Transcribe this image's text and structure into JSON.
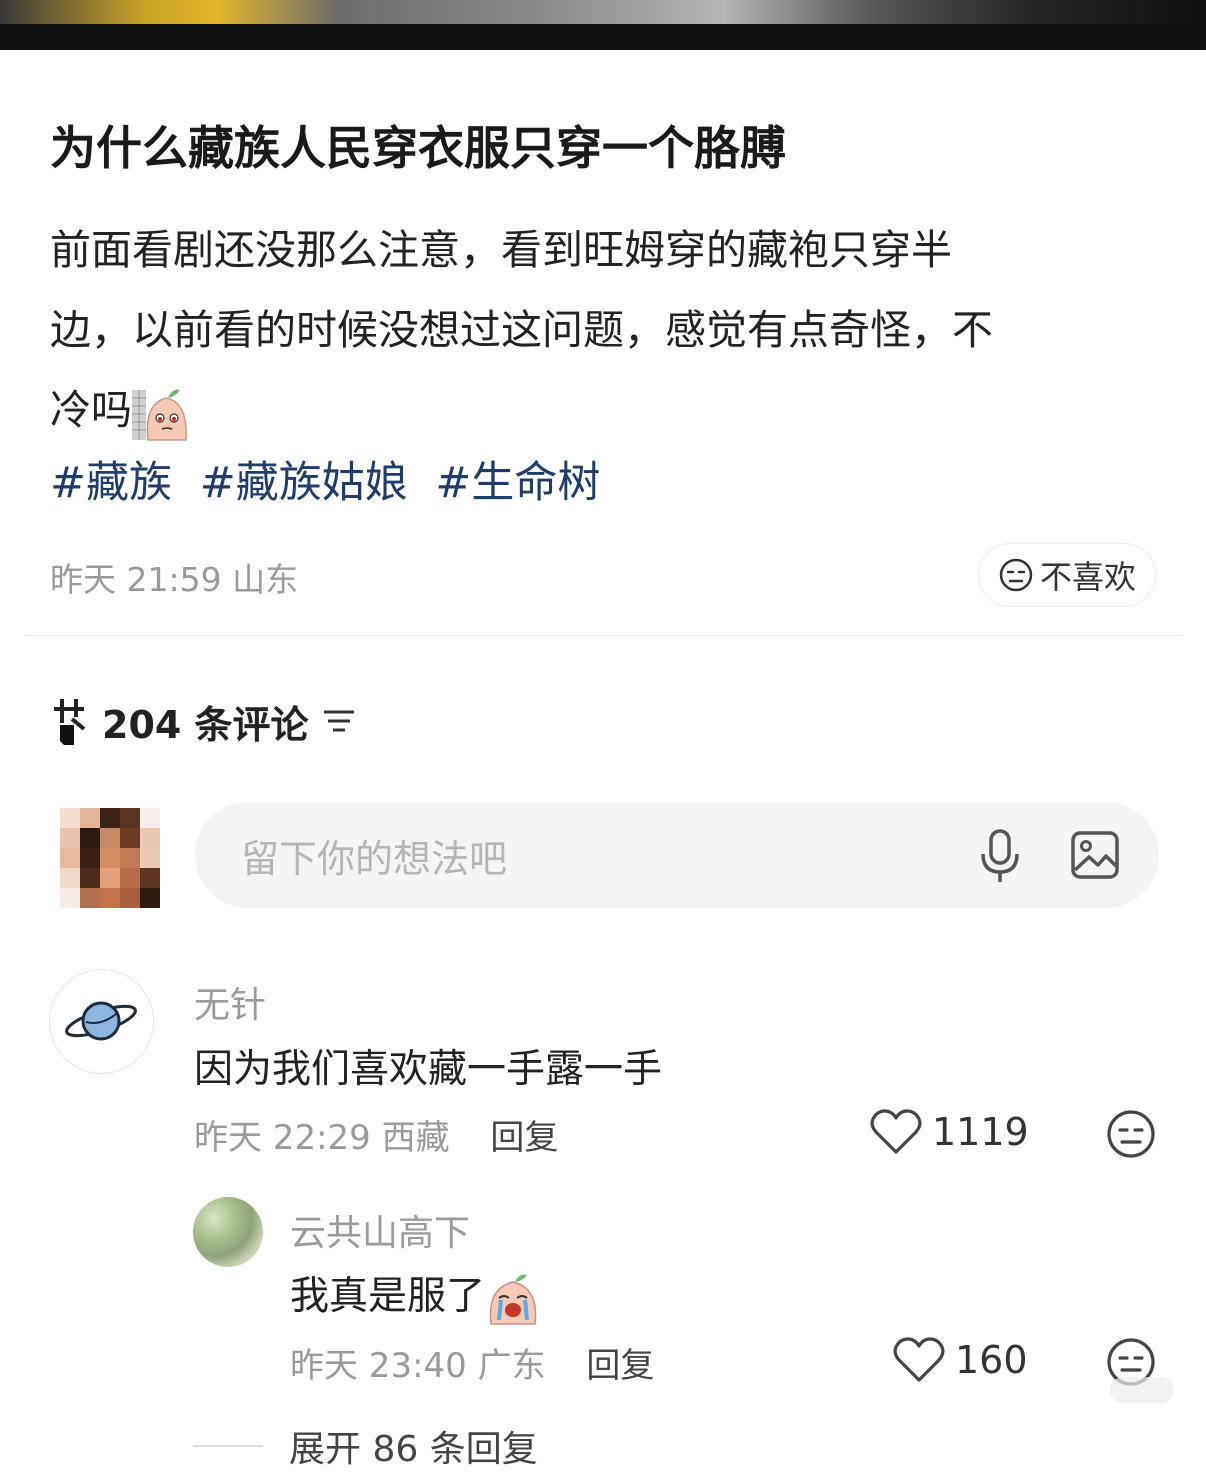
{
  "post": {
    "title": "为什么藏族人民穿衣服只穿一个胳膊",
    "body_line1": "前面看剧还没那么注意，看到旺姆穿的藏袍只穿半",
    "body_line2": "边，以前看的时候没想过这问题，感觉有点奇怪，不",
    "body_line3": "冷吗",
    "tags": [
      "#藏族",
      "#藏族姑娘",
      "#生命树"
    ],
    "time": "昨天 21:59",
    "location": "山东",
    "dislike_label": "不喜欢"
  },
  "comments_section": {
    "count_label": "204 条评论",
    "input_placeholder": "留下你的想法吧"
  },
  "comments": [
    {
      "author": "无针",
      "text": "因为我们喜欢藏一手露一手",
      "time": "昨天 22:29",
      "location": "西藏",
      "reply_label": "回复",
      "likes": "1119"
    }
  ],
  "replies": [
    {
      "author": "云共山高下",
      "text": "我真是服了",
      "time": "昨天 23:40",
      "location": "广东",
      "reply_label": "回复",
      "likes": "160"
    }
  ],
  "expand_label": "展开 86 条回复",
  "colors": {
    "tag": "#1f3c6b",
    "muted": "#9a9a9a",
    "input_bg": "#f4f4f4"
  },
  "icons": [
    "sticker-peach-wall-icon",
    "neutral-face-icon",
    "comment-count-icon",
    "sort-icon",
    "mic-icon",
    "image-icon",
    "planet-icon",
    "heart-icon",
    "crying-peach-sticker-icon"
  ]
}
